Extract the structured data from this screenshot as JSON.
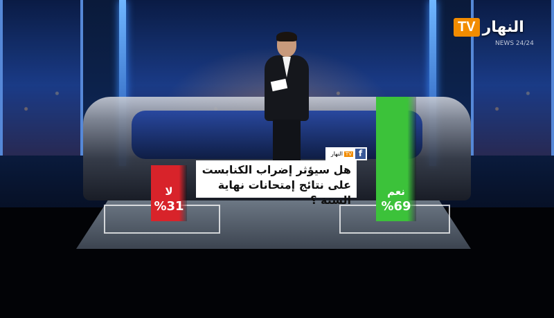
{
  "logo": {
    "tv": "TV",
    "name": "النهار",
    "sub": "NEWS 24/24"
  },
  "question_header": {
    "fb_icon": "f",
    "mini_logo_name": "النهار",
    "mini_logo_tv": "TV"
  },
  "colors": {
    "yes": "#3cc23a",
    "no": "#d8232a",
    "brand": "#f28c00"
  },
  "chart_data": {
    "type": "bar",
    "title": "هل سيؤثر إضراب الكنابست على نتائج إمتحانات نهاية السنة ؟",
    "categories": [
      "لا",
      "نعم"
    ],
    "values": [
      31,
      69
    ],
    "value_labels": [
      "%31",
      "%69"
    ],
    "unit": "%",
    "ylim": [
      0,
      100
    ],
    "xlabel": "",
    "ylabel": "",
    "grid": false,
    "legend": "none"
  }
}
